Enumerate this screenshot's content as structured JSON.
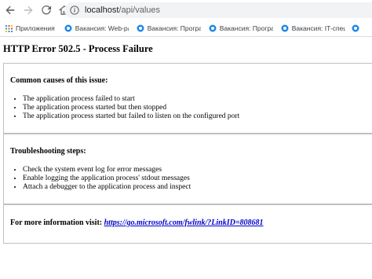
{
  "browser": {
    "url_host": "localhost",
    "url_path": "/api/values"
  },
  "bookmarks": {
    "apps_label": "Приложения",
    "items": [
      "Вакансия: Web-разр",
      "Вакансия: Програм",
      "Вакансия: Програм",
      "Вакансия: IT-специ"
    ]
  },
  "page": {
    "title": "HTTP Error 502.5 - Process Failure",
    "causes_heading": "Common causes of this issue:",
    "causes": [
      "The application process failed to start",
      "The application process started but then stopped",
      "The application process started but failed to listen on the configured port"
    ],
    "troubleshooting_heading": "Troubleshooting steps:",
    "troubleshooting": [
      "Check the system event log for error messages",
      "Enable logging the application process' stdout messages",
      "Attach a debugger to the application process and inspect"
    ],
    "more_info_label": "For more information visit:",
    "more_info_link": "https://go.microsoft.com/fwlink/?LinkID=808681"
  }
}
